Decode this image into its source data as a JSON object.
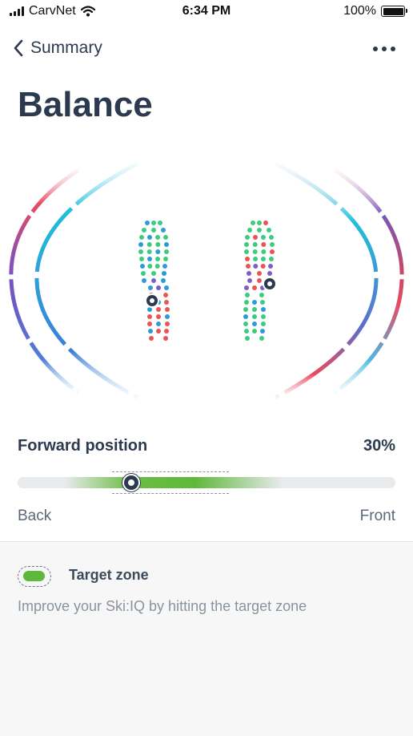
{
  "status_bar": {
    "carrier": "CarvNet",
    "time": "6:34 PM",
    "battery": "100%"
  },
  "nav": {
    "back_label": "Summary"
  },
  "page": {
    "title": "Balance"
  },
  "forward_position": {
    "label": "Forward position",
    "value_text": "30%",
    "value": 0.3,
    "min_label": "Back",
    "max_label": "Front",
    "target_zone": [
      0.25,
      0.56
    ]
  },
  "legend": {
    "label": "Target zone",
    "hint": "Improve your Ski:IQ by hitting the target zone"
  },
  "colors": {
    "accent_green": "#5fb83b",
    "text_dark": "#2b3a4f",
    "arc_cyan": "#1fc0dc",
    "arc_red": "#e84a5f",
    "arc_purple": "#7a55b8",
    "dot_green": "#3dcc7f",
    "dot_blue": "#2d9bdb",
    "dot_red": "#ea5455",
    "dot_purple": "#7c5fc4"
  },
  "icons": {
    "back": "chevron-left-icon",
    "more": "more-horizontal-icon",
    "legend": "target-zone-icon"
  }
}
